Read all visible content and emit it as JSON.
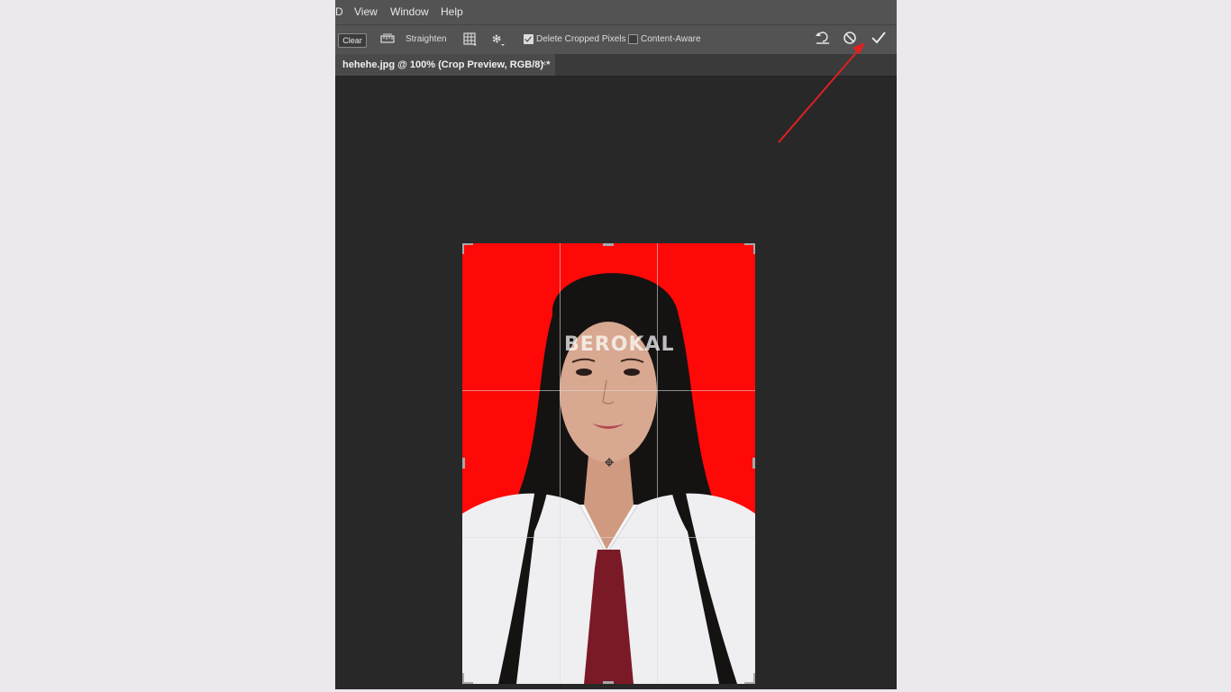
{
  "menu": {
    "cut_item": "D",
    "items": [
      "View",
      "Window",
      "Help"
    ]
  },
  "options": {
    "clear_label": "Clear",
    "straighten_label": "Straighten",
    "delete_cropped_label": "Delete Cropped Pixels",
    "delete_cropped_checked": true,
    "content_aware_label": "Content-Aware",
    "content_aware_checked": false
  },
  "document": {
    "tab_title": "hehehe.jpg @ 100% (Crop Preview, RGB/8) *",
    "close_symbol": "×"
  },
  "photo": {
    "watermark": "BEROKAL",
    "background_color": "#ff0808",
    "hair_color": "#151212",
    "skin_color": "#d8a890",
    "shirt_color": "#efeff2",
    "tie_color": "#7a1a26"
  },
  "icons": [
    "straighten-icon",
    "grid-overlay-icon",
    "settings-gear-icon",
    "reset-icon",
    "cancel-icon",
    "commit-checkmark-icon",
    "red-arrow-annotation"
  ],
  "colors": {
    "page_bg": "#ece9ee",
    "workspace_bg": "#282828",
    "toolbar_bg": "#535353",
    "annotation_red": "#e02020"
  }
}
